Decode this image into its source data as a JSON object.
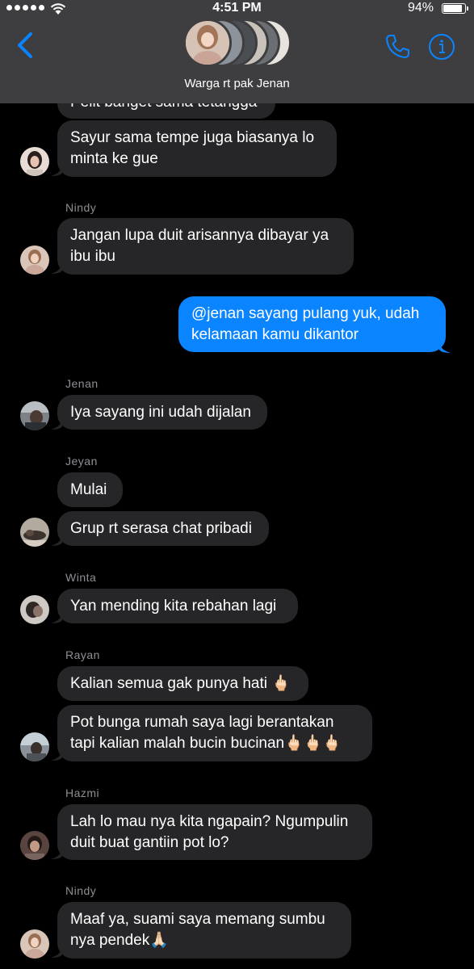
{
  "status_bar": {
    "time": "4:51 PM",
    "battery_percent": "94%",
    "battery_level": 0.94,
    "signal_bars": 5
  },
  "nav": {
    "title": "Warga rt pak Jenan",
    "back_icon": "chevron-left-icon",
    "call_icon": "phone-icon",
    "info_icon": "info-icon",
    "accent_color": "#0a84ff"
  },
  "messages": [
    {
      "type": "in",
      "text": "Pelit banget sama tetangga"
    },
    {
      "type": "in",
      "text": "Sayur sama tempe juga biasanya lo minta ke gue"
    },
    {
      "sender": "Nindy",
      "type": "in",
      "text": "Jangan lupa duit arisannya dibayar ya ibu ibu"
    },
    {
      "type": "out",
      "text": "@jenan sayang pulang yuk, udah kelamaan kamu dikantor"
    },
    {
      "sender": "Jenan",
      "type": "in",
      "text": "Iya sayang ini udah dijalan"
    },
    {
      "sender": "Jeyan",
      "type": "in",
      "text": "Mulai"
    },
    {
      "type": "in",
      "text": "Grup rt serasa chat pribadi"
    },
    {
      "sender": "Winta",
      "type": "in",
      "text": "Yan mending kita rebahan lagi"
    },
    {
      "sender": "Rayan",
      "type": "in",
      "text": "Kalian semua gak punya hati 🖕🏻"
    },
    {
      "type": "in",
      "text": "Pot bunga rumah saya lagi berantakan tapi kalian malah bucin bucinan🖕🏻🖕🏻🖕🏻"
    },
    {
      "sender": "Hazmi",
      "type": "in",
      "text": "Lah lo mau nya kita ngapain? Ngumpulin duit buat gantiin pot lo?"
    },
    {
      "sender": "Nindy",
      "type": "in",
      "text": "Maaf ya, suami saya memang sumbu nya pendek🙏🏻"
    }
  ],
  "colors": {
    "incoming_bubble": "#262628",
    "outgoing_bubble": "#0a84ff",
    "nav_bar": "#3e3e40",
    "sender_label": "#8e8e93"
  }
}
